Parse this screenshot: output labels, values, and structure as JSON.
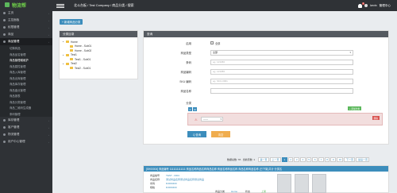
{
  "app": {
    "logo_text": "物流帮",
    "page_title": "北斗台板 / Test Company / 商品分类 / 搜索",
    "user_name": "kevin",
    "user_role": "管理中心",
    "notification_count": "1"
  },
  "sidebar": {
    "items": [
      {
        "label": "主页",
        "icon": "home-icon"
      },
      {
        "label": "主控面板",
        "icon": "dashboard-icon"
      },
      {
        "label": "权限管理",
        "icon": "key-icon"
      },
      {
        "label": "商品",
        "icon": "box-icon"
      },
      {
        "label": "商品管理",
        "icon": "tag-icon",
        "active": true
      }
    ],
    "sub_items": [
      {
        "label": "切换商品"
      },
      {
        "label": "商品品名管理"
      },
      {
        "label": "商品管理增维护",
        "active": true
      },
      {
        "label": "商品属性管理"
      },
      {
        "label": "商品入库管理"
      },
      {
        "label": "商品出库管理"
      },
      {
        "label": "商品库存管理"
      },
      {
        "label": "商品盘点管理"
      },
      {
        "label": "商品报表"
      },
      {
        "label": "商品分类管理"
      },
      {
        "label": "商品二维码生成器"
      },
      {
        "label": "条码管理"
      }
    ],
    "bottom_items": [
      {
        "label": "库存管理",
        "icon": "warehouse-icon"
      },
      {
        "label": "客户管理",
        "icon": "users-icon"
      },
      {
        "label": "物流管理",
        "icon": "truck-icon"
      },
      {
        "label": "用户中心管理",
        "icon": "user-icon"
      }
    ]
  },
  "toolbar": {
    "add_category_label": "+ 新增商品分类"
  },
  "category_panel": {
    "title": "分类目录",
    "tree": [
      {
        "label": "Home",
        "level": 0
      },
      {
        "label": "Home - Sub01",
        "level": 1
      },
      {
        "label": "Home - Sub02",
        "level": 1
      },
      {
        "label": "Test1",
        "level": 0
      },
      {
        "label": "Test1 - Sub01",
        "level": 1
      },
      {
        "label": "Test2",
        "level": 0
      },
      {
        "label": "Test2 - Sub01",
        "level": 1
      }
    ]
  },
  "search_panel": {
    "title": "查询",
    "fields": {
      "enable_label": "启用",
      "enable_option": "全部",
      "type_label": "商品类型",
      "type_value": "全部",
      "barcode_label": "条码",
      "barcode_placeholder": "eg. 123456",
      "short_code_label": "商品编码",
      "short_code_placeholder": "eg. 123456",
      "sku_label": "SKU 编码",
      "sku_placeholder": "eg. SKU-0001",
      "name_label": "商品名称",
      "name_value": "",
      "category_label": "分类"
    },
    "category_select": "------",
    "add_category_btn": "+ 添加分类",
    "delete_btn": "删除",
    "search_btn": "Q 查询",
    "clear_btn": "清空"
  },
  "pagination": {
    "info": "数据总数: 78 · 当前页数: 1",
    "first": "第一页",
    "prev": "上一页",
    "pages": [
      "1",
      "2",
      "3",
      "4",
      "5",
      "6",
      "7",
      "8",
      "9",
      "10"
    ],
    "next": "下一页",
    "last": "最后一页",
    "active_page": "1"
  },
  "result": {
    "header": "[SH00004] 商品编号 1111111111111 商品名称商品名称商品名称 商品名称商品名称 商品名称商品名称 (已下架)共计 分类名",
    "rows": [
      {
        "k": "商品编号",
        "v": "TEST - 0004"
      },
      {
        "k": "商品名称",
        "v": "测试商品名称测试商品名称测试商品"
      },
      {
        "k": "条码",
        "v": "RJ000400"
      },
      {
        "k": "规格",
        "v": "RJ000400"
      }
    ],
    "extra_label": "商品分类",
    "extra_value": "Home",
    "status_label": "状态",
    "status_value": "上架"
  }
}
